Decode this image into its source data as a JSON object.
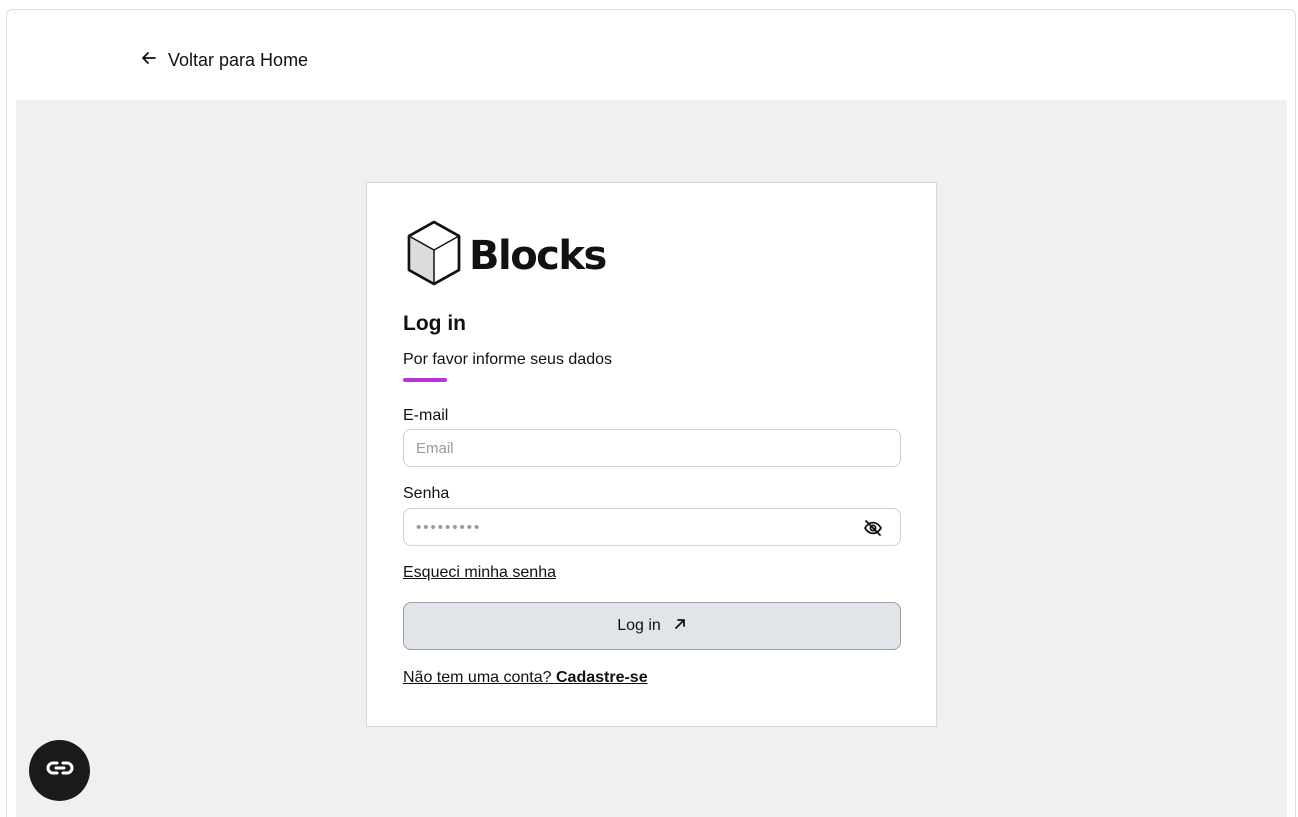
{
  "nav": {
    "back_label": "Voltar para Home"
  },
  "brand": {
    "name": "Blocks"
  },
  "login": {
    "title": "Log in",
    "subtitle": "Por favor informe seus dados",
    "accent_color": "#b832d6",
    "email_label": "E-mail",
    "email_placeholder": "Email",
    "email_value": "",
    "password_label": "Senha",
    "password_value": "•••••••••",
    "forgot_label": "Esqueci minha senha",
    "submit_label": "Log in",
    "signup_prompt": "Não tem uma conta?",
    "signup_link": "Cadastre-se"
  },
  "icons": {
    "back": "arrow-left-icon",
    "logo": "cube-icon",
    "password_toggle": "eye-off-icon",
    "submit": "arrow-up-right-icon",
    "floating": "link-icon"
  }
}
